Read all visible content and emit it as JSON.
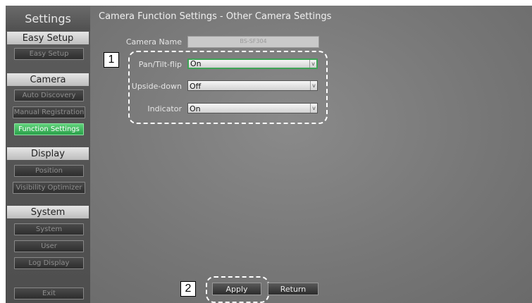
{
  "sidebar": {
    "title": "Settings",
    "sections": [
      {
        "header": "Easy Setup",
        "items": [
          "Easy Setup"
        ]
      },
      {
        "header": "Camera",
        "items": [
          "Auto Discovery",
          "Manual Registration",
          "Function Settings"
        ]
      },
      {
        "header": "Display",
        "items": [
          "Position",
          "Visibility Optimizer"
        ]
      },
      {
        "header": "System",
        "items": [
          "System",
          "User",
          "Log Display"
        ]
      }
    ],
    "exit": "Exit"
  },
  "main": {
    "title": "Camera Function Settings - Other Camera Settings",
    "camera_name_label": "Camera Name",
    "camera_name_value": "BS-SF304",
    "settings": [
      {
        "label": "Pan/Tilt-flip",
        "value": "On"
      },
      {
        "label": "Upside-down",
        "value": "Off"
      },
      {
        "label": "Indicator",
        "value": "On"
      }
    ],
    "apply_label": "Apply",
    "return_label": "Return"
  },
  "callouts": {
    "one": "1",
    "two": "2"
  },
  "colors": {
    "active": "#2aa14a",
    "sidebar": "#555555",
    "dashed": "#ffffff"
  }
}
